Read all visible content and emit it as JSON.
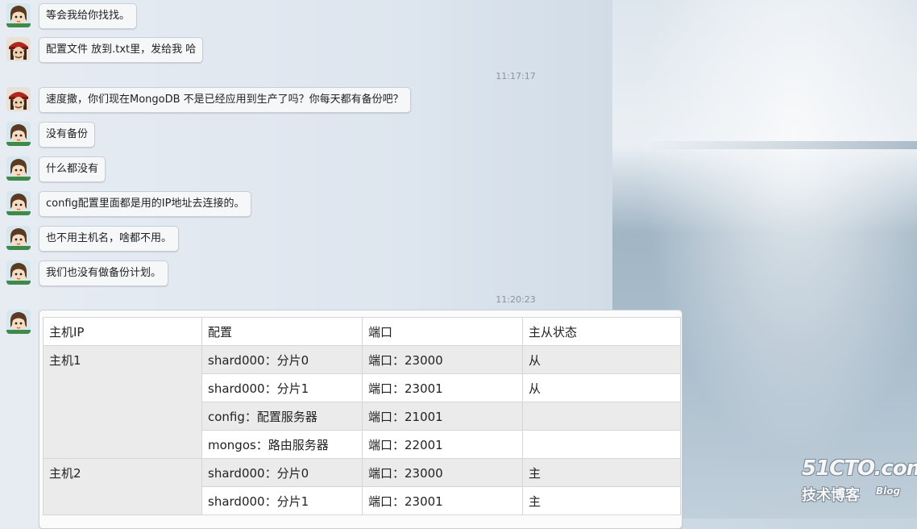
{
  "messages": [
    {
      "avatar": "girl-avatar-icon",
      "text": "等会我给你找找。"
    },
    {
      "avatar": "pirate-avatar-icon",
      "text": "配置文件 放到.txt里，发给我  哈"
    },
    {
      "avatar": "pirate-avatar-icon",
      "text": "速度撒，你们现在MongoDB 不是已经应用到生产了吗？你每天都有备份吧？"
    },
    {
      "avatar": "girl-avatar-icon",
      "text": "没有备份"
    },
    {
      "avatar": "girl-avatar-icon",
      "text": "什么都没有"
    },
    {
      "avatar": "girl-avatar-icon",
      "text": "config配置里面都是用的IP地址去连接的。"
    },
    {
      "avatar": "girl-avatar-icon",
      "text": "也不用主机名，啥都不用。"
    },
    {
      "avatar": "girl-avatar-icon",
      "text": "我们也没有做备份计划。"
    }
  ],
  "timestamps": [
    "11:17:17",
    "11:20:23"
  ],
  "table": {
    "headers": [
      "主机IP",
      "配置",
      "端口",
      "主从状态"
    ],
    "hosts": [
      "主机1",
      "主机2"
    ],
    "rows": [
      {
        "config": "shard000：分片0",
        "port": "端口：23000",
        "role": "从"
      },
      {
        "config": "shard000：分片1",
        "port": "端口：23001",
        "role": "从"
      },
      {
        "config": "config：配置服务器",
        "port": "端口：21001",
        "role": ""
      },
      {
        "config": "mongos：路由服务器",
        "port": "端口：22001",
        "role": ""
      },
      {
        "config": "shard000：分片0",
        "port": "端口：23000",
        "role": "主"
      },
      {
        "config": "shard000：分片1",
        "port": "端口：23001",
        "role": "主"
      }
    ]
  },
  "watermark": {
    "site": "51CTO.com",
    "subtitle": "技术博客",
    "blog": "Blog"
  }
}
